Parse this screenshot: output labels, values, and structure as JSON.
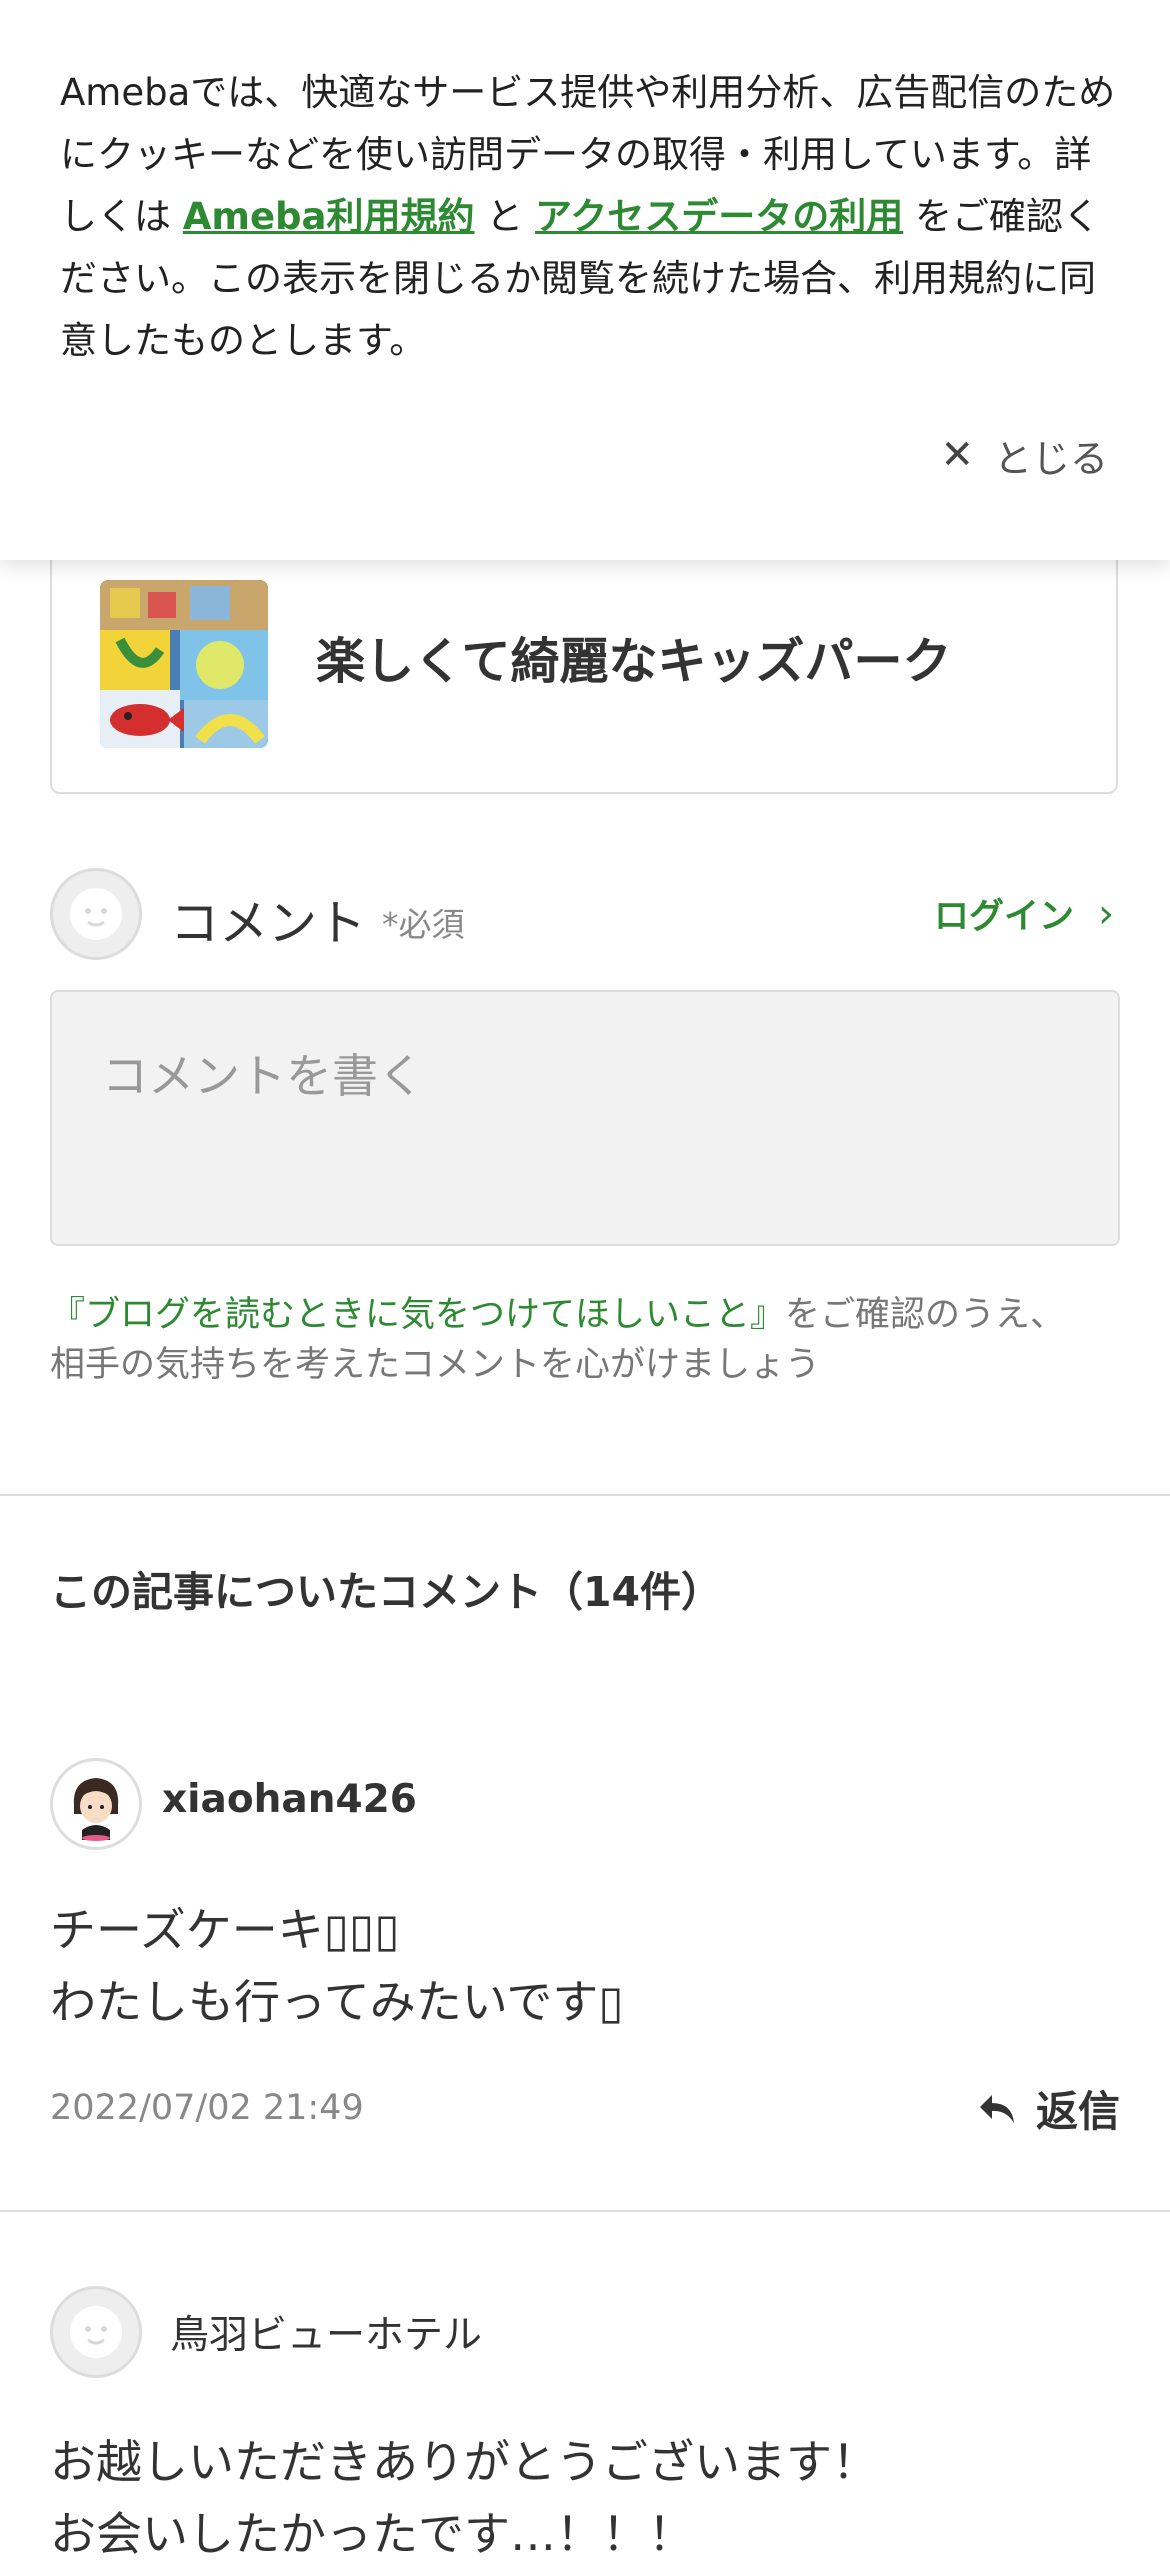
{
  "cookie_banner": {
    "text_1": "Amebaでは、快適なサービス提供や利用分析、広告配信のためにクッキーなどを使い訪問データの取得・利用しています。詳しくは ",
    "link_terms": "Ameba利用規約",
    "text_2": " と ",
    "link_access": "アクセスデータの利用",
    "text_3": " をご確認ください。この表示を閉じるか閲覧を続けた場合、利用規約に同意したものとします。",
    "close_label": "とじる"
  },
  "article_card": {
    "title": "楽しくて綺麗なキッズパーク"
  },
  "comment_form": {
    "label": "コメント",
    "required": "*必須",
    "login": "ログイン",
    "placeholder": "コメントを書く",
    "guide_link": "『ブログを読むときに気をつけてほしいこと』",
    "guide_text_1": "をご確認のうえ、",
    "guide_text_2": "相手の気持ちを考えたコメントを心がけましょう"
  },
  "comments_section": {
    "title": "この記事についたコメント（14件）",
    "comments": [
      {
        "author": "xiaohan426",
        "line_1": "チーズケーキ▯▯▯",
        "line_2": "わたしも行ってみたいです▯",
        "date": "2022/07/02 21:49",
        "reply": "返信"
      },
      {
        "author": "鳥羽ビューホテル",
        "line_1": "お越しいただきありがとうございます！",
        "line_2": "お会いしたかったです…！！！"
      }
    ]
  },
  "colors": {
    "accent_green": "#2d8a32",
    "divider": "#dddddd"
  }
}
